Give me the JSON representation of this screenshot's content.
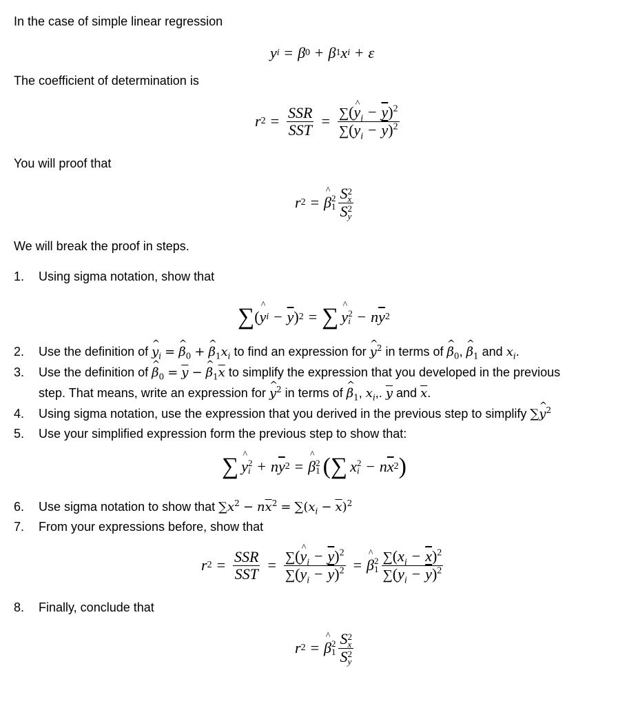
{
  "document": {
    "intro": "In the case of simple linear regression",
    "model_equation": "yᵢ = β₀ + β₁xᵢ + ε",
    "coefficient_label": "The coefficient of determination is",
    "r2_definition": "r² = SSR/SST = Σ(ŷᵢ − ȳ)² / Σ(yᵢ − ȳ)²",
    "proof_intro": "You will proof that",
    "proof_target": "r² = β̂₁² S²ₓ / S²ᵧ",
    "steps_intro": "We will break the proof in steps.",
    "steps": [
      {
        "number": "1.",
        "text": "Using sigma notation, show that",
        "equation": "Σ(ŷᵢ − ȳ)² = Σŷᵢ² − nȳ²"
      },
      {
        "number": "2.",
        "text_parts": [
          "Use the definition of",
          "to find an expression for",
          "in terms of",
          "and",
          "."
        ],
        "text": "Use the definition of ŷᵢ = β̂₀ + β̂₁xᵢ to find an expression for ŷᵢ² in terms of β̂₀, β̂₁ and xᵢ."
      },
      {
        "number": "3.",
        "text_parts": [
          "Use the definition of",
          "to simplify the expression that you developed in the previous",
          "step. That means, write an expression for",
          "in terms of",
          "and"
        ],
        "text": "Use the definition of β̂₀ = ȳ − β̂₁x̄ to simplify the expression that you developed in the previous step. That means, write an expression for ŷᵢ² in terms of β̂₁, xᵢ,. ȳ and x̄."
      },
      {
        "number": "4.",
        "text_parts": [
          "Using sigma notation, use the expression that you derived in the previous step to simplify"
        ],
        "text": "Using sigma notation, use the expression that you derived in the previous step to simplify Σŷᵢ²"
      },
      {
        "number": "5.",
        "text": "Use your simplified expression form the previous step to show that:",
        "equation": "Σŷᵢ² + nȳ² = β̂₁²(Σxᵢ² − nx̄²)"
      },
      {
        "number": "6.",
        "text_parts": [
          "Use sigma notation to show that"
        ],
        "text": "Use sigma notation to show that Σxᵢ² − nx̄² = Σ(xᵢ − x̄)²"
      },
      {
        "number": "7.",
        "text": "From your expressions before, show that",
        "equation": "r² = SSR/SST = Σ(ŷᵢ − ȳ)²/Σ(yᵢ − ȳ)² = β̂₁² Σ(xᵢ − x̄)²/Σ(yᵢ − ȳ)²"
      },
      {
        "number": "8.",
        "text": "Finally, conclude that",
        "equation": "r² = β̂₁² S²ₓ / S²ᵧ"
      }
    ],
    "symbols": {
      "r": "r",
      "two": "2",
      "eq": "=",
      "plus": "+",
      "minus": "−",
      "sigma": "∑",
      "lparen": "(",
      "rparen": ")",
      "SSR": "SSR",
      "SST": "SST",
      "S": "S",
      "x": "x",
      "y": "y",
      "i": "i",
      "n": "n",
      "beta": "β",
      "zero": "0",
      "one": "1",
      "epsilon": "ε",
      "comma": ",",
      "period": ".",
      "comma_period": ",."
    }
  }
}
